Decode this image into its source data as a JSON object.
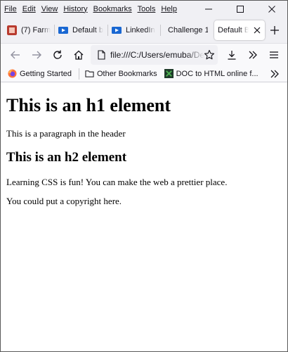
{
  "menu": [
    "File",
    "Edit",
    "View",
    "History",
    "Bookmarks",
    "Tools",
    "Help"
  ],
  "tabs": [
    {
      "label": "(7) Farm",
      "icon": "youtube-icon",
      "color": "#c0392b"
    },
    {
      "label": "Default b",
      "icon": "video-icon",
      "color": "#1a73e8"
    },
    {
      "label": "LinkedIn",
      "icon": "video-icon",
      "color": "#1a73e8"
    },
    {
      "label": "Challenge 1",
      "icon": "",
      "color": ""
    },
    {
      "label": "Default Br",
      "icon": "",
      "color": "",
      "active": true
    }
  ],
  "address_bar": {
    "url": "file:///C:/Users/emuba/De"
  },
  "bookmarks": [
    {
      "label": "Getting Started",
      "icon": "firefox-icon"
    },
    {
      "label": "Other Bookmarks",
      "icon": "folder-icon"
    },
    {
      "label": "DOC to HTML online f...",
      "icon": "doc-icon"
    }
  ],
  "page": {
    "h1": "This is an h1 element",
    "p_header": "This is a paragraph in the header",
    "h2": "This is an h2 element",
    "p_body": "Learning CSS is fun! You can make the web a prettier place.",
    "p_footer": "You could put a copyright here."
  },
  "colors": {
    "chrome_bg": "#f0f0f4",
    "toolbar_bg": "#f9f9fb",
    "text": "#15141a"
  }
}
